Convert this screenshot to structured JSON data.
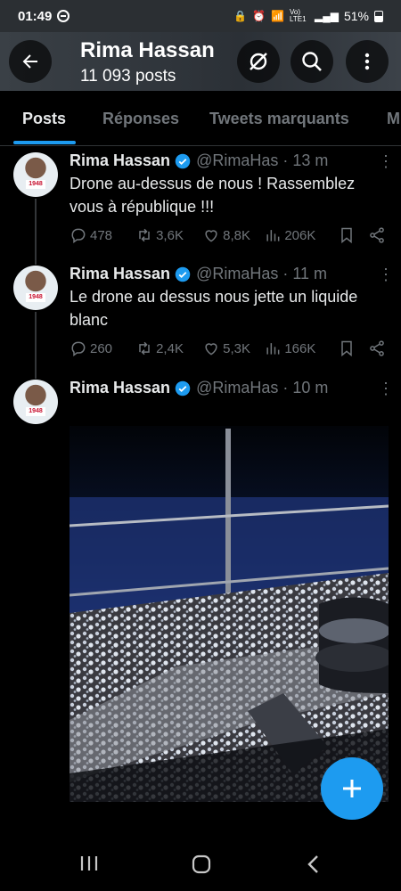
{
  "status_bar": {
    "time": "01:49",
    "network": "Vo) LTE1",
    "battery": "51%"
  },
  "header": {
    "title": "Rima Hassan",
    "subtitle": "11 093 posts"
  },
  "tabs": [
    {
      "label": "Posts",
      "active": true
    },
    {
      "label": "Réponses",
      "active": false
    },
    {
      "label": "Tweets marquants",
      "active": false
    },
    {
      "label": "M",
      "active": false
    }
  ],
  "tweets": [
    {
      "name": "Rima Hassan",
      "handle": "@RimaHas · 13 m",
      "text": "Drone au-dessus de nous ! Rassemblez vous à république !!!",
      "replies": "478",
      "retweets": "3,6K",
      "likes": "8,8K",
      "views": "206K"
    },
    {
      "name": "Rima Hassan",
      "handle": "@RimaHas · 11 m",
      "text": "Le drone au dessus nous jette un liquide blanc",
      "replies": "260",
      "retweets": "2,4K",
      "likes": "5,3K",
      "views": "166K"
    },
    {
      "name": "Rima Hassan",
      "handle": "@RimaHas · 10 m",
      "text": ""
    }
  ],
  "avatar_badge": "1948",
  "icons": {
    "back": "arrow-left-icon",
    "grok": "grok-icon",
    "search": "search-icon",
    "more": "more-vertical-icon",
    "verified": "verified-badge-icon",
    "reply": "reply-icon",
    "retweet": "retweet-icon",
    "like": "heart-icon",
    "views": "views-icon",
    "bookmark": "bookmark-icon",
    "share": "share-icon",
    "compose": "plus-icon"
  },
  "colors": {
    "accent": "#1d9bf0",
    "background": "#000000",
    "text_secondary": "#71767b"
  }
}
